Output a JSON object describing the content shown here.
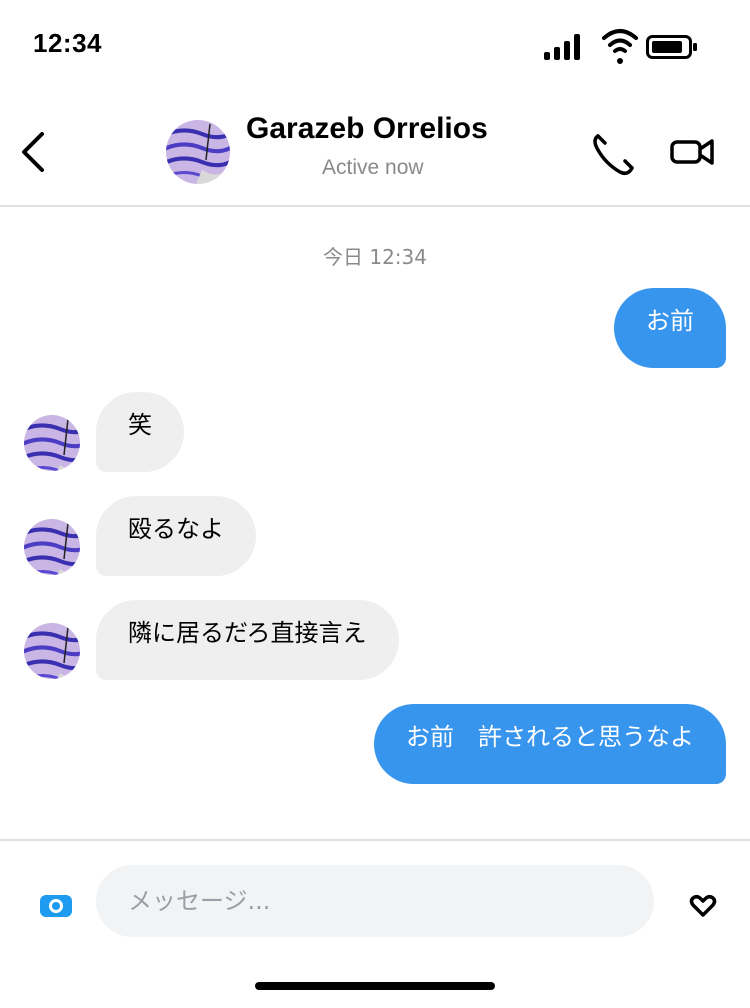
{
  "status_bar": {
    "time": "12:34"
  },
  "header": {
    "contact_name": "Garazeb Orrelios",
    "contact_status": "Active now",
    "icons": {
      "back": "chevron-left-icon",
      "call": "phone-icon",
      "video": "video-camera-icon"
    }
  },
  "chat": {
    "timestamp": "今日 12:34",
    "messages": [
      {
        "direction": "outgoing",
        "text": "お前"
      },
      {
        "direction": "incoming",
        "text": "笑"
      },
      {
        "direction": "incoming",
        "text": "殴るなよ"
      },
      {
        "direction": "incoming",
        "text": "隣に居るだろ直接言え"
      },
      {
        "direction": "outgoing",
        "text": "お前　許されると思うなよ"
      }
    ]
  },
  "composer": {
    "placeholder": "メッセージ...",
    "value": "",
    "icons": {
      "camera": "camera-icon",
      "like": "heart-icon"
    }
  },
  "colors": {
    "outgoing_bubble": "#3895ed",
    "incoming_bubble": "#efefef",
    "muted_text": "#8a8a8a",
    "divider": "#e1e1e1"
  }
}
